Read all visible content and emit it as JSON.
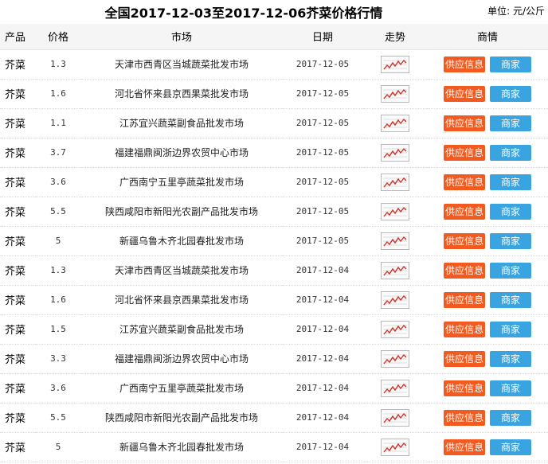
{
  "title": "全国2017-12-03至2017-12-06芥菜价格行情",
  "unit": {
    "label": "单位:",
    "value": "元/公斤"
  },
  "columns": [
    "产品",
    "价格",
    "市场",
    "日期",
    "走势",
    "商情"
  ],
  "buttons": {
    "supply": "供应信息",
    "merchant": "商家"
  },
  "icons": {
    "trend": "trend-chart-icon"
  },
  "colors": {
    "supply_button": "#f25a1f",
    "merchant_button": "#3aa4e0",
    "trend_line": "#d0332a"
  },
  "rows": [
    {
      "product": "芥菜",
      "price": "1.3",
      "market": "天津市西青区当城蔬菜批发市场",
      "date": "2017-12-05"
    },
    {
      "product": "芥菜",
      "price": "1.6",
      "market": "河北省怀来县京西果菜批发市场",
      "date": "2017-12-05"
    },
    {
      "product": "芥菜",
      "price": "1.1",
      "market": "江苏宜兴蔬菜副食品批发市场",
      "date": "2017-12-05"
    },
    {
      "product": "芥菜",
      "price": "3.7",
      "market": "福建福鼎闽浙边界农贸中心市场",
      "date": "2017-12-05"
    },
    {
      "product": "芥菜",
      "price": "3.6",
      "market": "广西南宁五里亭蔬菜批发市场",
      "date": "2017-12-05"
    },
    {
      "product": "芥菜",
      "price": "5.5",
      "market": "陕西咸阳市新阳光农副产品批发市场",
      "date": "2017-12-05"
    },
    {
      "product": "芥菜",
      "price": "5",
      "market": "新疆乌鲁木齐北园春批发市场",
      "date": "2017-12-05"
    },
    {
      "product": "芥菜",
      "price": "1.3",
      "market": "天津市西青区当城蔬菜批发市场",
      "date": "2017-12-04"
    },
    {
      "product": "芥菜",
      "price": "1.6",
      "market": "河北省怀来县京西果菜批发市场",
      "date": "2017-12-04"
    },
    {
      "product": "芥菜",
      "price": "1.5",
      "market": "江苏宜兴蔬菜副食品批发市场",
      "date": "2017-12-04"
    },
    {
      "product": "芥菜",
      "price": "3.3",
      "market": "福建福鼎闽浙边界农贸中心市场",
      "date": "2017-12-04"
    },
    {
      "product": "芥菜",
      "price": "3.6",
      "market": "广西南宁五里亭蔬菜批发市场",
      "date": "2017-12-04"
    },
    {
      "product": "芥菜",
      "price": "5.5",
      "market": "陕西咸阳市新阳光农副产品批发市场",
      "date": "2017-12-04"
    },
    {
      "product": "芥菜",
      "price": "5",
      "market": "新疆乌鲁木齐北园春批发市场",
      "date": "2017-12-04"
    }
  ]
}
